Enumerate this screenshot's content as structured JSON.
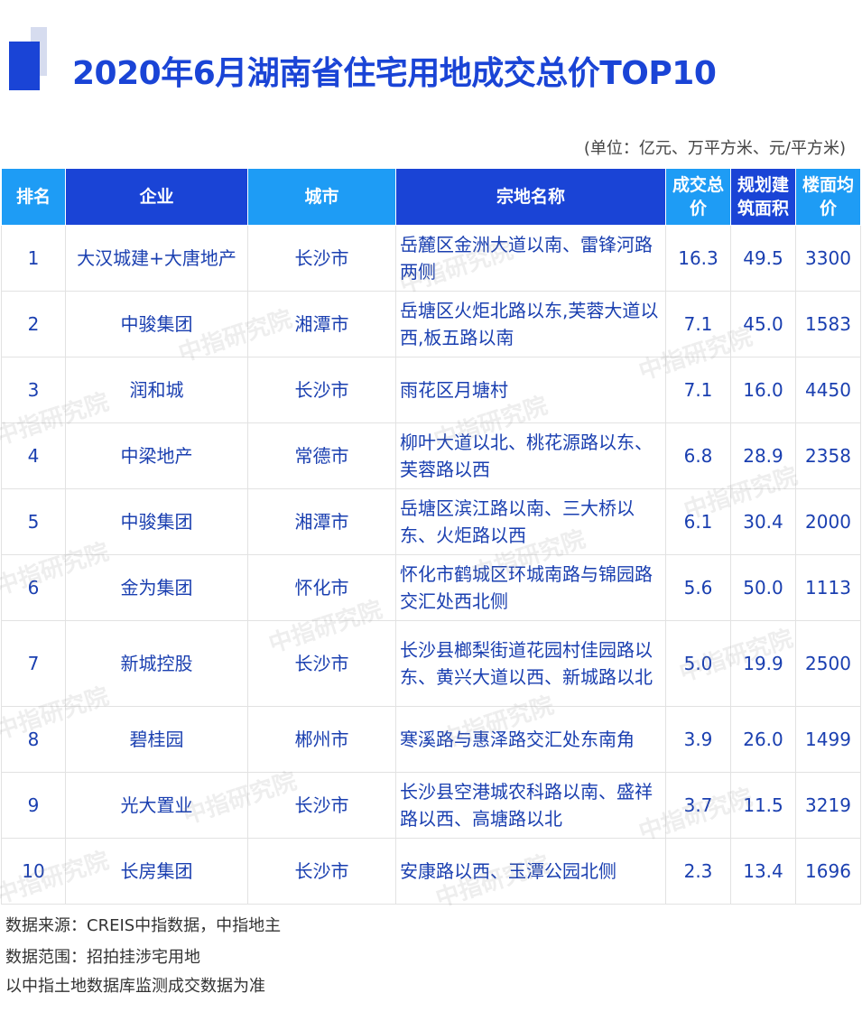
{
  "title": "2020年6月湖南省住宅用地成交总价TOP10",
  "unit_note": "(单位：亿元、万平方米、元/平方米)",
  "watermark_text": "中指研究院",
  "colors": {
    "header_light": "#1e9cf5",
    "header_dark": "#1a44d6",
    "text": "#1a3fb0"
  },
  "table": {
    "headers": [
      "排名",
      "企业",
      "城市",
      "宗地名称",
      "成交总价",
      "规划建筑面积",
      "楼面均价"
    ],
    "rows": [
      [
        "1",
        "大汉城建+大唐地产",
        "长沙市",
        "岳麓区金洲大道以南、雷锋河路两侧",
        "16.3",
        "49.5",
        "3300"
      ],
      [
        "2",
        "中骏集团",
        "湘潭市",
        "岳塘区火炬北路以东,芙蓉大道以西,板五路以南",
        "7.1",
        "45.0",
        "1583"
      ],
      [
        "3",
        "润和城",
        "长沙市",
        "雨花区月塘村",
        "7.1",
        "16.0",
        "4450"
      ],
      [
        "4",
        "中梁地产",
        "常德市",
        "柳叶大道以北、桃花源路以东、芙蓉路以西",
        "6.8",
        "28.9",
        "2358"
      ],
      [
        "5",
        "中骏集团",
        "湘潭市",
        "岳塘区滨江路以南、三大桥以东、火炬路以西",
        "6.1",
        "30.4",
        "2000"
      ],
      [
        "6",
        "金为集团",
        "怀化市",
        "怀化市鹤城区环城南路与锦园路交汇处西北侧",
        "5.6",
        "50.0",
        "1113"
      ],
      [
        "7",
        "新城控股",
        "长沙市",
        "长沙县榔梨街道花园村佳园路以东、黄兴大道以西、新城路以北",
        "5.0",
        "19.9",
        "2500"
      ],
      [
        "8",
        "碧桂园",
        "郴州市",
        "寒溪路与惠泽路交汇处东南角",
        "3.9",
        "26.0",
        "1499"
      ],
      [
        "9",
        "光大置业",
        "长沙市",
        "长沙县空港城农科路以南、盛祥路以西、高塘路以北",
        "3.7",
        "11.5",
        "3219"
      ],
      [
        "10",
        "长房集团",
        "长沙市",
        "安康路以西、玉潭公园北侧",
        "2.3",
        "13.4",
        "1696"
      ]
    ]
  },
  "footnotes": [
    "数据来源：CREIS中指数据，中指地主",
    "数据范围：招拍挂涉宅用地",
    "以中指土地数据库监测成交数据为准"
  ]
}
